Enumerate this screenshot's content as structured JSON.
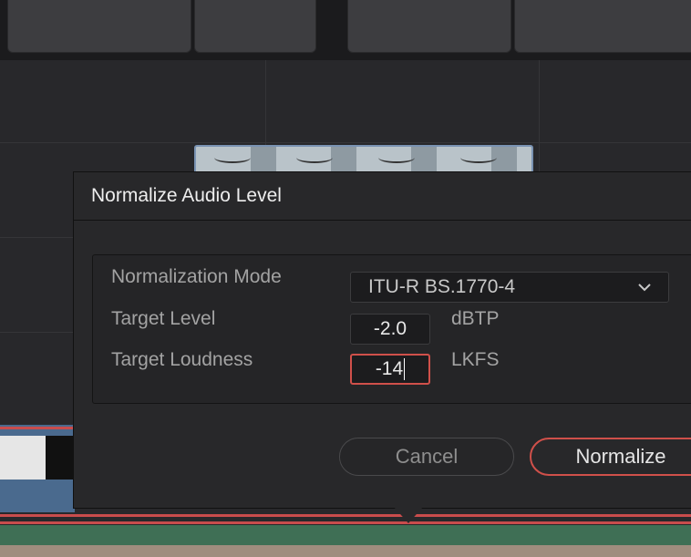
{
  "dialog": {
    "title": "Normalize Audio Level",
    "rows": {
      "mode_label": "Normalization Mode",
      "mode_value": "ITU-R BS.1770-4",
      "level_label": "Target Level",
      "level_value": "-2.0",
      "level_unit": "dBTP",
      "loudness_label": "Target Loudness",
      "loudness_value": "-14",
      "loudness_unit": "LKFS"
    },
    "buttons": {
      "cancel": "Cancel",
      "normalize": "Normalize"
    }
  },
  "colors": {
    "accent_red": "#d0504a",
    "dialog_bg": "#28282a",
    "audio_track_green": "#3f6f55",
    "clip_blue": "#4a6a8e"
  },
  "icons": {
    "dropdown": "chevron-down-icon"
  }
}
